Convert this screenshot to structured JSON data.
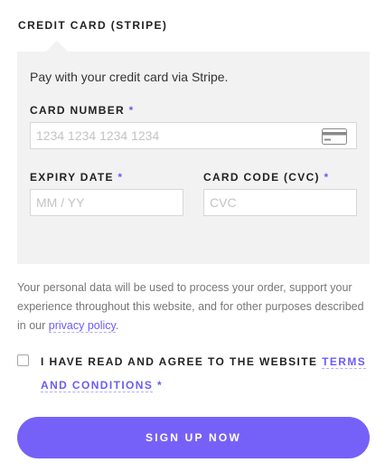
{
  "payment": {
    "method_label": "CREDIT CARD (STRIPE)",
    "description": "Pay with your credit card via Stripe.",
    "card_number": {
      "label": "CARD NUMBER",
      "required": "*",
      "placeholder": "1234 1234 1234 1234",
      "icon": "credit-card-icon"
    },
    "expiry": {
      "label": "EXPIRY DATE",
      "required": "*",
      "placeholder": "MM / YY"
    },
    "cvc": {
      "label": "CARD CODE (CVC)",
      "required": "*",
      "placeholder": "CVC"
    }
  },
  "privacy": {
    "text": "Your personal data will be used to process your order, support your experience throughout this website, and for other purposes described in our ",
    "link": "privacy policy",
    "end": "."
  },
  "terms": {
    "text": "I HAVE READ AND AGREE TO THE WEBSITE ",
    "link": "TERMS AND CONDITIONS",
    "required": "*",
    "checked": false
  },
  "submit": {
    "label": "SIGN UP NOW"
  },
  "colors": {
    "accent": "#7661f8",
    "link": "#6b5cf5",
    "panel": "#f2f2f2"
  }
}
